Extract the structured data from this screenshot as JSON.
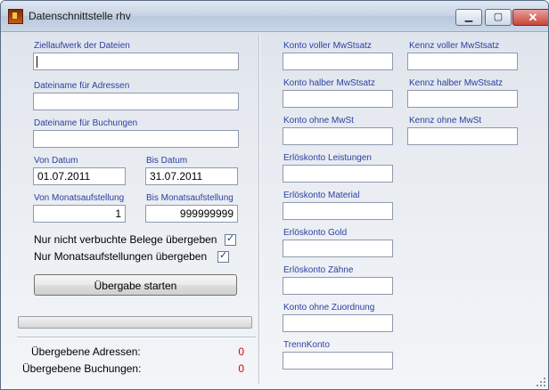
{
  "window": {
    "title": "Datenschnittstelle rhv",
    "controls": {
      "minimize": "▁",
      "maximize": "▢",
      "close": "✕"
    }
  },
  "left": {
    "ziellaufwerk_label": "Ziellaufwerk der Dateien",
    "ziellaufwerk_value": "",
    "adressen_label": "Dateiname für Adressen",
    "adressen_value": "",
    "buchungen_label": "Dateiname für Buchungen",
    "buchungen_value": "",
    "von_datum_label": "Von Datum",
    "von_datum_value": "01.07.2011",
    "bis_datum_label": "Bis Datum",
    "bis_datum_value": "31.07.2011",
    "von_monat_label": "Von Monatsaufstellung",
    "von_monat_value": "1",
    "bis_monat_label": "Bis Monatsaufstellung",
    "bis_monat_value": "999999999",
    "chk_belege_label": "Nur nicht verbuchte Belege übergeben",
    "chk_belege_checked": true,
    "chk_monat_label": "Nur Monatsaufstellungen übergeben",
    "chk_monat_checked": true,
    "start_button": "Übergabe starten",
    "progress_value": 0,
    "adressen_count_label": "Übergebene Adressen:",
    "adressen_count": "0",
    "buchungen_count_label": "Übergebene Buchungen:",
    "buchungen_count": "0"
  },
  "right": {
    "konten": [
      {
        "label": "Konto voller MwStsatz",
        "value": ""
      },
      {
        "label": "Konto halber MwStsatz",
        "value": ""
      },
      {
        "label": "Konto ohne MwSt",
        "value": ""
      },
      {
        "label": "Erlöskonto Leistungen",
        "value": ""
      },
      {
        "label": "Erlöskonto Material",
        "value": ""
      },
      {
        "label": "Erlöskonto Gold",
        "value": ""
      },
      {
        "label": "Erlöskonto Zähne",
        "value": ""
      },
      {
        "label": "Konto ohne Zuordnung",
        "value": ""
      },
      {
        "label": "TrennKonto",
        "value": ""
      }
    ],
    "kennz": [
      {
        "label": "Kennz voller MwStsatz",
        "value": ""
      },
      {
        "label": "Kennz halber MwStsatz",
        "value": ""
      },
      {
        "label": "Kennz ohne MwSt",
        "value": ""
      }
    ]
  },
  "colors": {
    "label_blue": "#2b3fa0",
    "count_red": "#e00000"
  }
}
